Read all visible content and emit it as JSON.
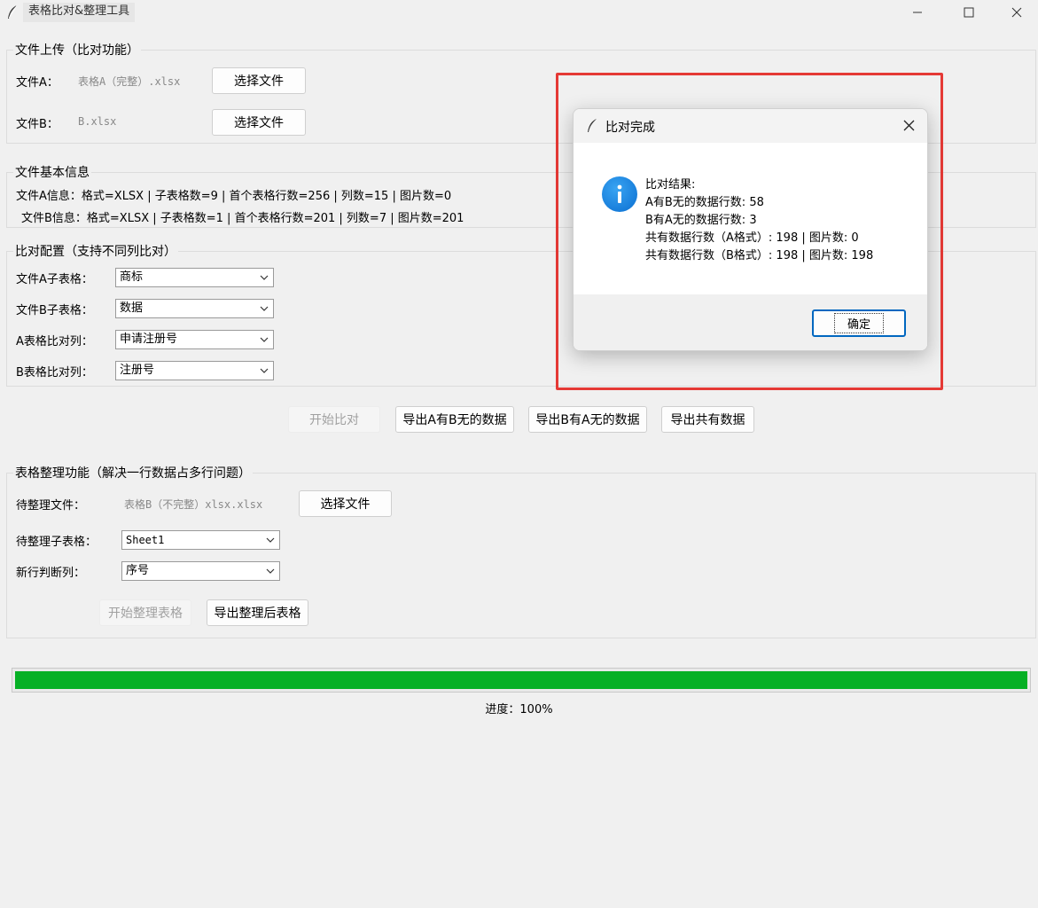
{
  "window": {
    "title": "表格比对&整理工具"
  },
  "upload": {
    "title": "文件上传（比对功能）",
    "file_a_label": "文件A：",
    "file_a_name": "表格A（完整）.xlsx",
    "file_b_label": "文件B：",
    "file_b_name": "B.xlsx",
    "choose_label": "选择文件"
  },
  "info": {
    "title": "文件基本信息",
    "file_a_info": "文件A信息：格式=XLSX | 子表格数=9 | 首个表格行数=256 | 列数=15 | 图片数=0",
    "file_b_info": "文件B信息：格式=XLSX | 子表格数=1 | 首个表格行数=201 | 列数=7 | 图片数=201"
  },
  "config": {
    "title": "比对配置（支持不同列比对）",
    "sheet_a_label": "文件A子表格：",
    "sheet_a_value": "商标",
    "sheet_b_label": "文件B子表格：",
    "sheet_b_value": "数据",
    "col_a_label": "A表格比对列：",
    "col_a_value": "申请注册号",
    "col_b_label": "B表格比对列：",
    "col_b_value": "注册号"
  },
  "actions": {
    "start_compare": "开始比对",
    "export_a_not_b": "导出A有B无的数据",
    "export_b_not_a": "导出B有A无的数据",
    "export_common": "导出共有数据"
  },
  "organize": {
    "title": "表格整理功能（解决一行数据占多行问题）",
    "file_label": "待整理文件：",
    "file_name": "表格B（不完整）xlsx.xlsx",
    "choose_label": "选择文件",
    "sheet_label": "待整理子表格：",
    "sheet_value": "Sheet1",
    "newline_label": "新行判断列：",
    "newline_value": "序号",
    "start_label": "开始整理表格",
    "export_label": "导出整理后表格"
  },
  "progress": {
    "value": 100,
    "text": "进度：100%"
  },
  "dialog": {
    "title": "比对完成",
    "line1": "比对结果:",
    "line2": "A有B无的数据行数: 58",
    "line3": "B有A无的数据行数: 3",
    "line4": "共有数据行数（A格式）: 198 | 图片数: 0",
    "line5": "共有数据行数（B格式）: 198 | 图片数: 198",
    "ok_label": "确定"
  },
  "colors": {
    "progress": "#06b025",
    "highlight": "#e53935",
    "info_icon": "#0a6ed1"
  }
}
